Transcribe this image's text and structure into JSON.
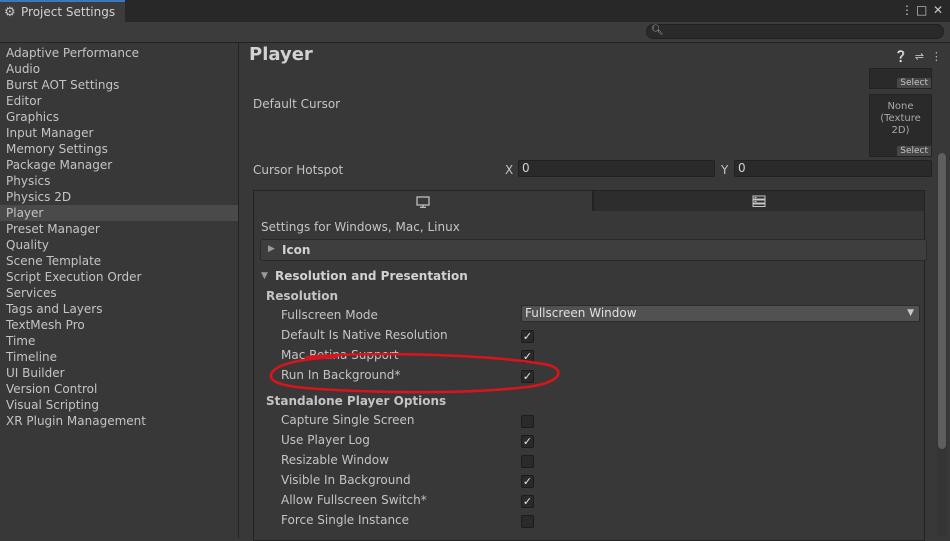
{
  "window": {
    "tab_title": "Project Settings",
    "controls": [
      "⋮",
      "□",
      "✕"
    ]
  },
  "search": {
    "placeholder": "",
    "value": ""
  },
  "sidebar": {
    "items": [
      "Adaptive Performance",
      "Audio",
      "Burst AOT Settings",
      "Editor",
      "Graphics",
      "Input Manager",
      "Memory Settings",
      "Package Manager",
      "Physics",
      "Physics 2D",
      "Player",
      "Preset Manager",
      "Quality",
      "Scene Template",
      "Script Execution Order",
      "Services",
      "Tags and Layers",
      "TextMesh Pro",
      "Time",
      "Timeline",
      "UI Builder",
      "Version Control",
      "Visual Scripting",
      "XR Plugin Management"
    ],
    "selected": "Player"
  },
  "header": {
    "title": "Player",
    "icons": [
      "help-icon",
      "preset-icon",
      "more-icon"
    ]
  },
  "top_fields": {
    "select_label": "Select",
    "default_cursor_label": "Default Cursor",
    "cursor_texture_text_1": "None",
    "cursor_texture_text_2": "(Texture 2D)",
    "cursor_select_label": "Select",
    "cursor_hotspot_label": "Cursor Hotspot",
    "x_label": "X",
    "x_value": "0",
    "y_label": "Y",
    "y_value": "0"
  },
  "platform_tabs": [
    "desktop-icon",
    "server-icon"
  ],
  "panel": {
    "settings_title": "Settings for Windows, Mac, Linux",
    "icon_foldout": "Icon",
    "res_foldout": "Resolution and Presentation",
    "resolution_header": "Resolution",
    "fullscreen_mode_label": "Fullscreen Mode",
    "fullscreen_mode_value": "Fullscreen Window",
    "resolution_rows": [
      {
        "label": "Default Is Native Resolution",
        "checked": true
      },
      {
        "label": "Mac Retina Support",
        "checked": true
      },
      {
        "label": "Run In Background*",
        "checked": true
      }
    ],
    "standalone_header": "Standalone Player Options",
    "standalone_rows": [
      {
        "label": "Capture Single Screen",
        "checked": false
      },
      {
        "label": "Use Player Log",
        "checked": true
      },
      {
        "label": "Resizable Window",
        "checked": false
      },
      {
        "label": "Visible In Background",
        "checked": true
      },
      {
        "label": "Allow Fullscreen Switch*",
        "checked": true
      },
      {
        "label": "Force Single Instance",
        "checked": false
      }
    ]
  },
  "colors": {
    "annotation": "#d8141c",
    "tab_accent": "#3a79bb"
  }
}
